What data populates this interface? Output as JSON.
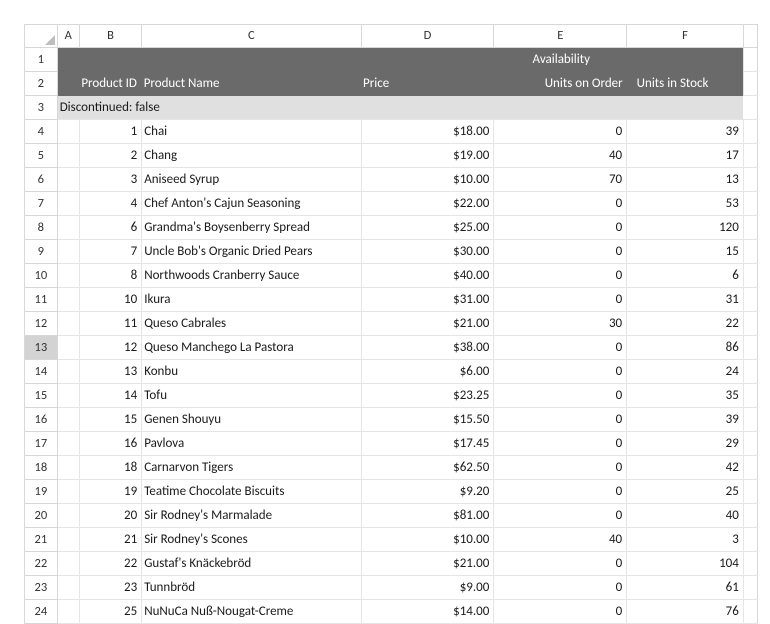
{
  "columns": {
    "letters": [
      "A",
      "B",
      "C",
      "D",
      "E",
      "F"
    ],
    "row_header_blank": ""
  },
  "header": {
    "availability": "Availability",
    "product_id": "Product ID",
    "product_name": "Product Name",
    "price": "Price",
    "units_on_order": "Units on Order",
    "units_in_stock": "Units in Stock"
  },
  "group_label": "Discontinued: false",
  "row_numbers": [
    "1",
    "2",
    "3",
    "4",
    "5",
    "6",
    "7",
    "8",
    "9",
    "10",
    "11",
    "12",
    "13",
    "14",
    "15",
    "16",
    "17",
    "18",
    "19",
    "20",
    "21",
    "22",
    "23",
    "24"
  ],
  "selected_row_number": "13",
  "rows": [
    {
      "id": "1",
      "name": "Chai",
      "price": "$18.00",
      "on_order": "0",
      "in_stock": "39"
    },
    {
      "id": "2",
      "name": "Chang",
      "price": "$19.00",
      "on_order": "40",
      "in_stock": "17"
    },
    {
      "id": "3",
      "name": "Aniseed Syrup",
      "price": "$10.00",
      "on_order": "70",
      "in_stock": "13"
    },
    {
      "id": "4",
      "name": "Chef Anton's Cajun Seasoning",
      "price": "$22.00",
      "on_order": "0",
      "in_stock": "53"
    },
    {
      "id": "6",
      "name": "Grandma's Boysenberry Spread",
      "price": "$25.00",
      "on_order": "0",
      "in_stock": "120"
    },
    {
      "id": "7",
      "name": "Uncle Bob's Organic Dried Pears",
      "price": "$30.00",
      "on_order": "0",
      "in_stock": "15"
    },
    {
      "id": "8",
      "name": "Northwoods Cranberry Sauce",
      "price": "$40.00",
      "on_order": "0",
      "in_stock": "6"
    },
    {
      "id": "10",
      "name": "Ikura",
      "price": "$31.00",
      "on_order": "0",
      "in_stock": "31"
    },
    {
      "id": "11",
      "name": "Queso Cabrales",
      "price": "$21.00",
      "on_order": "30",
      "in_stock": "22"
    },
    {
      "id": "12",
      "name": "Queso Manchego La Pastora",
      "price": "$38.00",
      "on_order": "0",
      "in_stock": "86"
    },
    {
      "id": "13",
      "name": "Konbu",
      "price": "$6.00",
      "on_order": "0",
      "in_stock": "24"
    },
    {
      "id": "14",
      "name": "Tofu",
      "price": "$23.25",
      "on_order": "0",
      "in_stock": "35"
    },
    {
      "id": "15",
      "name": "Genen Shouyu",
      "price": "$15.50",
      "on_order": "0",
      "in_stock": "39"
    },
    {
      "id": "16",
      "name": "Pavlova",
      "price": "$17.45",
      "on_order": "0",
      "in_stock": "29"
    },
    {
      "id": "18",
      "name": "Carnarvon Tigers",
      "price": "$62.50",
      "on_order": "0",
      "in_stock": "42"
    },
    {
      "id": "19",
      "name": "Teatime Chocolate Biscuits",
      "price": "$9.20",
      "on_order": "0",
      "in_stock": "25"
    },
    {
      "id": "20",
      "name": "Sir Rodney's Marmalade",
      "price": "$81.00",
      "on_order": "0",
      "in_stock": "40"
    },
    {
      "id": "21",
      "name": "Sir Rodney's Scones",
      "price": "$10.00",
      "on_order": "40",
      "in_stock": "3"
    },
    {
      "id": "22",
      "name": "Gustaf's Knäckebröd",
      "price": "$21.00",
      "on_order": "0",
      "in_stock": "104"
    },
    {
      "id": "23",
      "name": "Tunnbröd",
      "price": "$9.00",
      "on_order": "0",
      "in_stock": "61"
    },
    {
      "id": "25",
      "name": "NuNuCa Nuß-Nougat-Creme",
      "price": "$14.00",
      "on_order": "0",
      "in_stock": "76"
    }
  ]
}
